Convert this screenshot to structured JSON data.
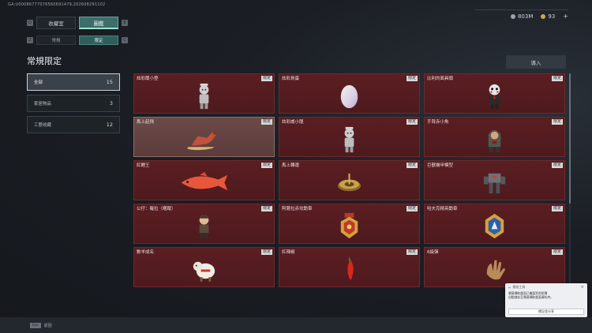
{
  "uid": "GA:U00086777076560691479,202608291102",
  "currency": {
    "silver": "803M",
    "gold": "93",
    "plus": "+"
  },
  "tabs": [
    {
      "key": "Q",
      "label": "收藏室"
    },
    {
      "label": "圖鑑",
      "active": true
    },
    {
      "key": "E"
    }
  ],
  "subtabs": {
    "left_key": "Z",
    "items": [
      {
        "label": "常規"
      },
      {
        "label": "限定",
        "active": true
      }
    ],
    "right_key": "C"
  },
  "page_title": "常規限定",
  "import_label": "導入",
  "categories": [
    {
      "label": "全部",
      "count": "15",
      "active": true
    },
    {
      "label": "家居物品",
      "count": "3"
    },
    {
      "label": "工藝收藏",
      "count": "12"
    }
  ],
  "badge": "限定",
  "items": [
    {
      "name": "炫彩蘭小登",
      "art": "figure"
    },
    {
      "name": "炫彩鳥蛋",
      "art": "egg"
    },
    {
      "name": "比利的面具頭",
      "art": "puppet"
    },
    {
      "name": "馬上起飛",
      "art": "horse",
      "highlighted": true
    },
    {
      "name": "炫彩威小龍",
      "art": "figure"
    },
    {
      "name": "手臂赤小魚",
      "art": "hoodie"
    },
    {
      "name": "紅鯉王",
      "art": "fish"
    },
    {
      "name": "馬上轉運",
      "art": "compass"
    },
    {
      "name": "巨獸機甲模型",
      "art": "mech"
    },
    {
      "name": "公仔：羅拉（暱蹤）",
      "art": "doll"
    },
    {
      "name": "阿薩拉赤坟勳章",
      "art": "medal-red"
    },
    {
      "name": "哈夫克精英勳章",
      "art": "medal-blue"
    },
    {
      "name": "數羊成名",
      "art": "sheep"
    },
    {
      "name": "紅辣椒",
      "art": "pepper"
    },
    {
      "name": "6級彈",
      "art": "hand"
    }
  ],
  "toast": {
    "app": "擅長工具",
    "line1": "螢幕擷取畫面已複製到剪貼簿",
    "line2": "自動儲存至螢幕擷取畫面資料夾。",
    "button": "標記並分享",
    "close": "×"
  },
  "footer": {
    "esc": "Esc",
    "label": "返回"
  },
  "colors": {
    "card": "#5b1e22",
    "accent": "#3c6e6a"
  }
}
